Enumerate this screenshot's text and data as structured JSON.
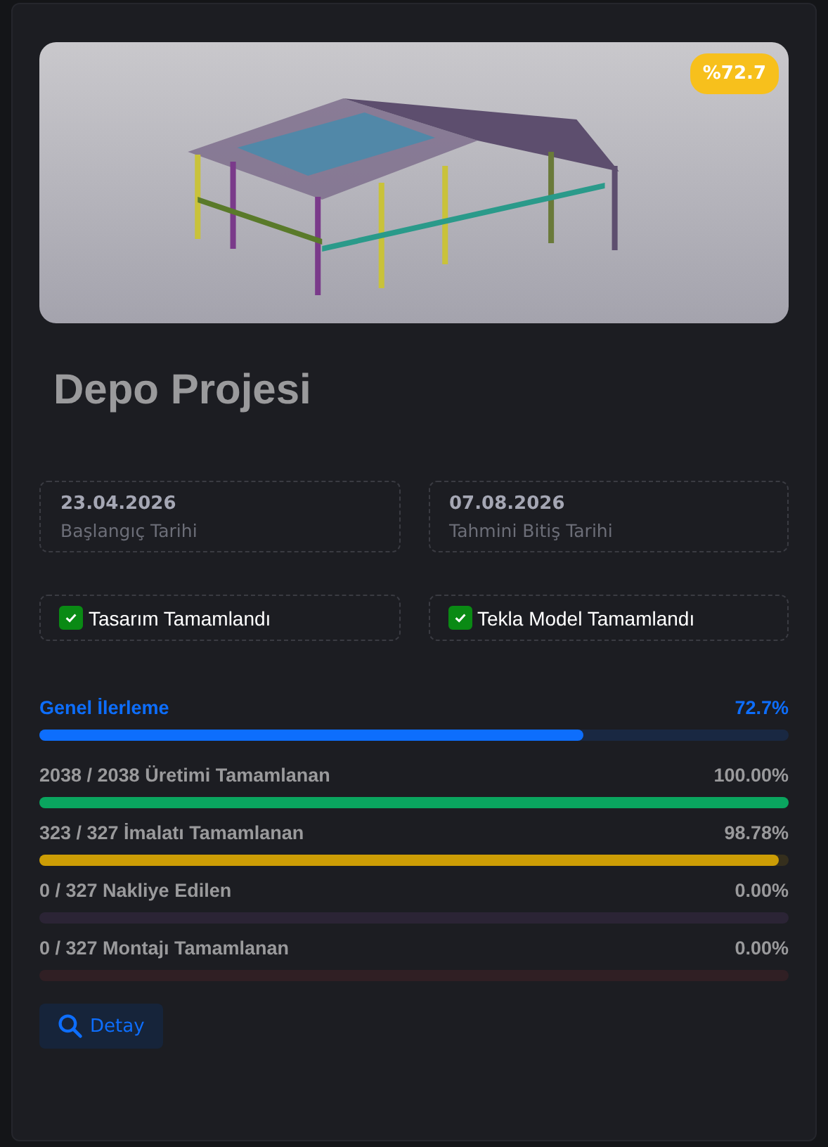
{
  "project": {
    "badge": "%72.7",
    "title": "Depo Projesi"
  },
  "dates": [
    {
      "value": "23.04.2026",
      "label": "Başlangıç Tarihi"
    },
    {
      "value": "07.08.2026",
      "label": "Tahmini Bitiş Tarihi"
    }
  ],
  "milestones": [
    {
      "label": "Tasarım Tamamlandı",
      "checked": true
    },
    {
      "label": "Tekla Model Tamamlandı",
      "checked": true
    }
  ],
  "progress": [
    {
      "kind": "overall",
      "label": "Genel İlerleme",
      "value": "72.7%",
      "level": 0.727,
      "color": "#0d6efd"
    },
    {
      "kind": "stage",
      "label": "2038 / 2038 Üretimi Tamamlanan",
      "value": "100.00%",
      "level": 1.0,
      "color": "#0aa55f"
    },
    {
      "kind": "stage",
      "label": "323 / 327 İmalatı Tamamlanan",
      "value": "98.78%",
      "level": 0.9878,
      "color": "#cc9d05"
    },
    {
      "kind": "stage",
      "label": "0 / 327 Nakliye Edilen",
      "value": "0.00%",
      "color": "#2b2435"
    },
    {
      "kind": "stage",
      "label": "0 / 327 Montajı Tamamlanan",
      "value": "0.00%",
      "color": "#301f24"
    }
  ],
  "detail_button": "Detay"
}
